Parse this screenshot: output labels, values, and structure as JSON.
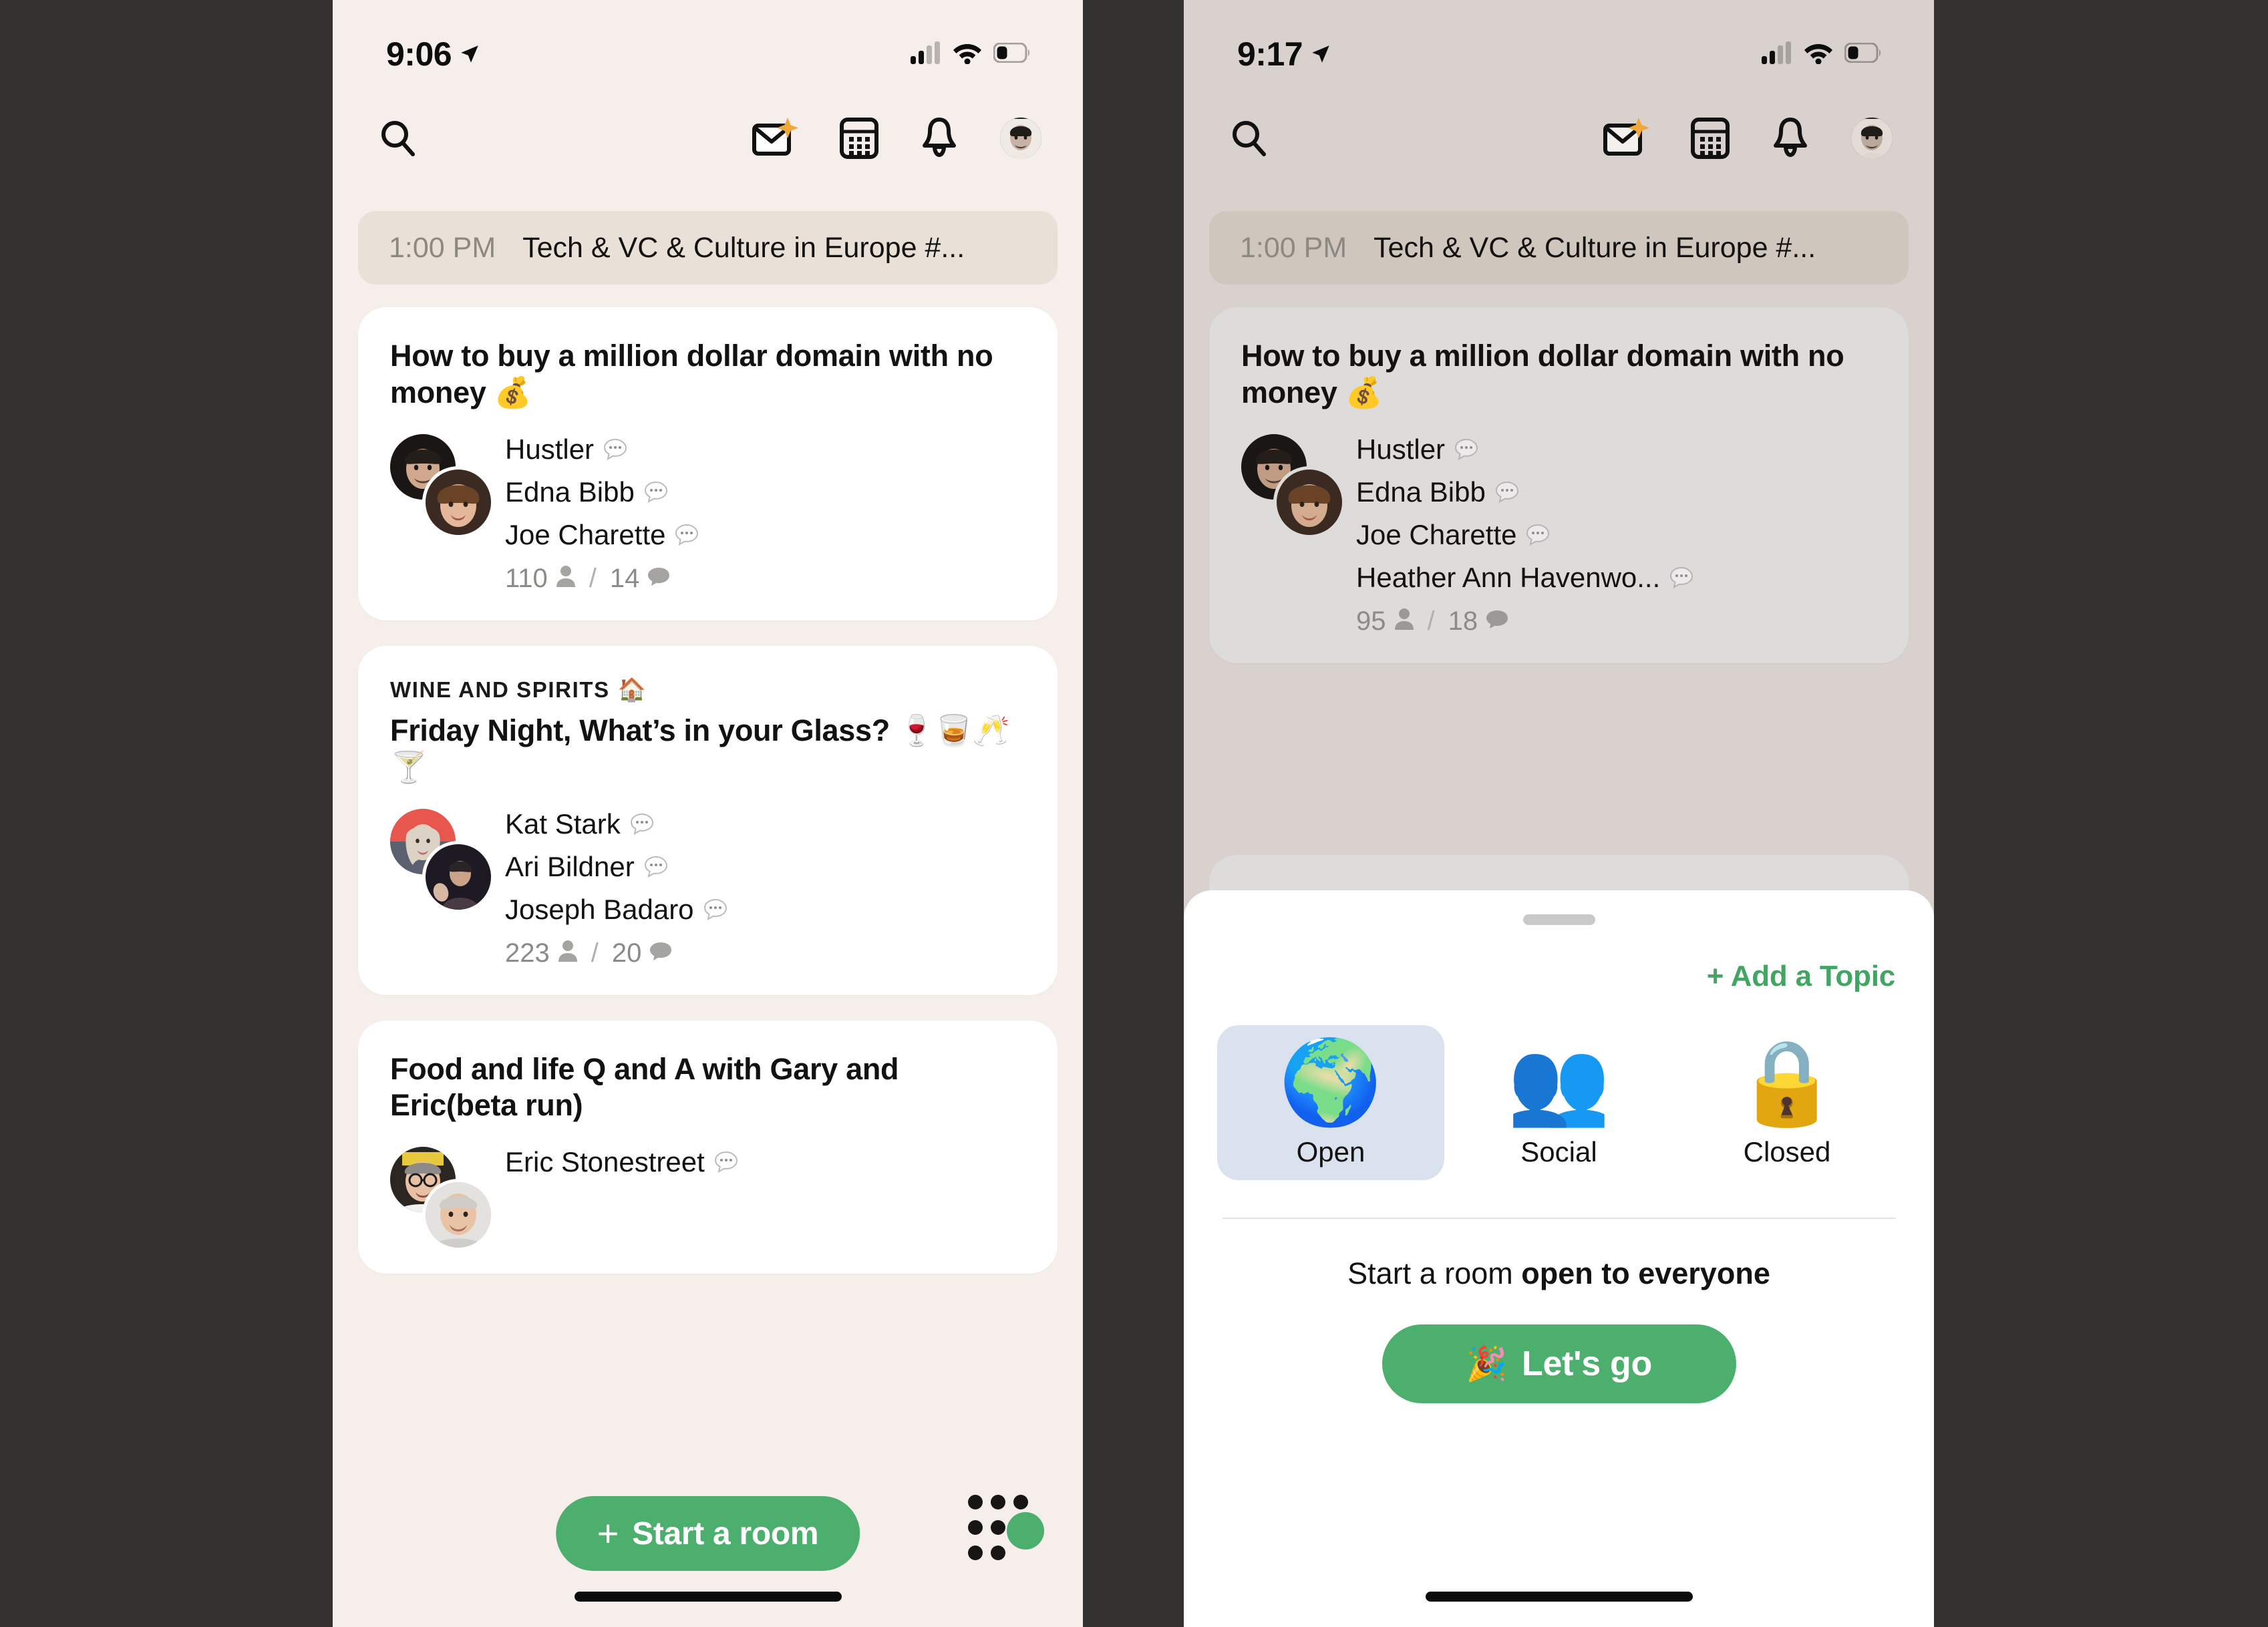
{
  "theme": {
    "page_background": "#333231",
    "left_phone_background": "#f6eeea",
    "right_phone_background": "#d8d1cd",
    "accent_green": "#4caf6d",
    "link_green": "#43a563",
    "selected_tile": "#dbe2ef"
  },
  "left_phone": {
    "status_bar": {
      "time": "9:06",
      "location_icon": "location-arrow-icon",
      "cellular_icon": "cellular-signal-icon",
      "wifi_icon": "wifi-icon",
      "battery_icon": "battery-icon"
    },
    "nav": {
      "search_icon": "search-icon",
      "invite_icon": "invite-envelope-icon",
      "calendar_icon": "calendar-icon",
      "bell_icon": "bell-icon",
      "avatar_icon": "profile-avatar"
    },
    "event_banner": {
      "time": "1:00 PM",
      "title": "Tech & VC & Culture in Europe #..."
    },
    "cards": [
      {
        "club": null,
        "club_emoji": null,
        "title": "How to buy a million dollar domain with no money 💰",
        "speakers": [
          "Hustler",
          "Edna Bibb",
          "Joe Charette"
        ],
        "listeners": "110",
        "speaking": "14"
      },
      {
        "club": "WINE AND SPIRITS",
        "club_emoji": "🏠",
        "title": "Friday Night, What’s in your Glass? 🍷🥃🥂🍸",
        "speakers": [
          "Kat Stark",
          "Ari Bildner",
          "Joseph Badaro"
        ],
        "listeners": "223",
        "speaking": "20"
      },
      {
        "club": null,
        "club_emoji": null,
        "title": "Food and life Q and A with Gary and Eric(beta run)",
        "speakers": [
          "Eric Stonestreet"
        ],
        "listeners": null,
        "speaking": null
      }
    ],
    "bottom_bar": {
      "start_room_label": "Start a room",
      "start_room_plus": "+",
      "people_grid_icon": "people-grid-icon"
    }
  },
  "right_phone": {
    "status_bar": {
      "time": "9:17",
      "location_icon": "location-arrow-icon",
      "cellular_icon": "cellular-signal-icon",
      "wifi_icon": "wifi-icon",
      "battery_icon": "battery-icon"
    },
    "nav": {
      "search_icon": "search-icon",
      "invite_icon": "invite-envelope-icon",
      "calendar_icon": "calendar-icon",
      "bell_icon": "bell-icon",
      "avatar_icon": "profile-avatar"
    },
    "event_banner": {
      "time": "1:00 PM",
      "title": "Tech & VC & Culture in Europe #..."
    },
    "cards": [
      {
        "title": "How to buy a million dollar domain with no money 💰",
        "speakers": [
          "Hustler",
          "Edna Bibb",
          "Joe Charette",
          "Heather Ann Havenwo..."
        ],
        "listeners": "95",
        "speaking": "18"
      }
    ],
    "sheet": {
      "handle_icon": "drag-handle",
      "add_topic_label": "+ Add a Topic",
      "room_types": [
        {
          "emoji": "🌍",
          "label": "Open",
          "icon_name": "globe-icon",
          "selected": true
        },
        {
          "emoji": "👥",
          "label": "Social",
          "icon_name": "people-icon",
          "selected": false
        },
        {
          "emoji": "🔒",
          "label": "Closed",
          "icon_name": "lock-icon",
          "selected": false
        }
      ],
      "caption_prefix": "Start a room ",
      "caption_bold": "open to everyone",
      "lets_go_emoji": "🎉",
      "lets_go_label": "Let's go"
    }
  }
}
